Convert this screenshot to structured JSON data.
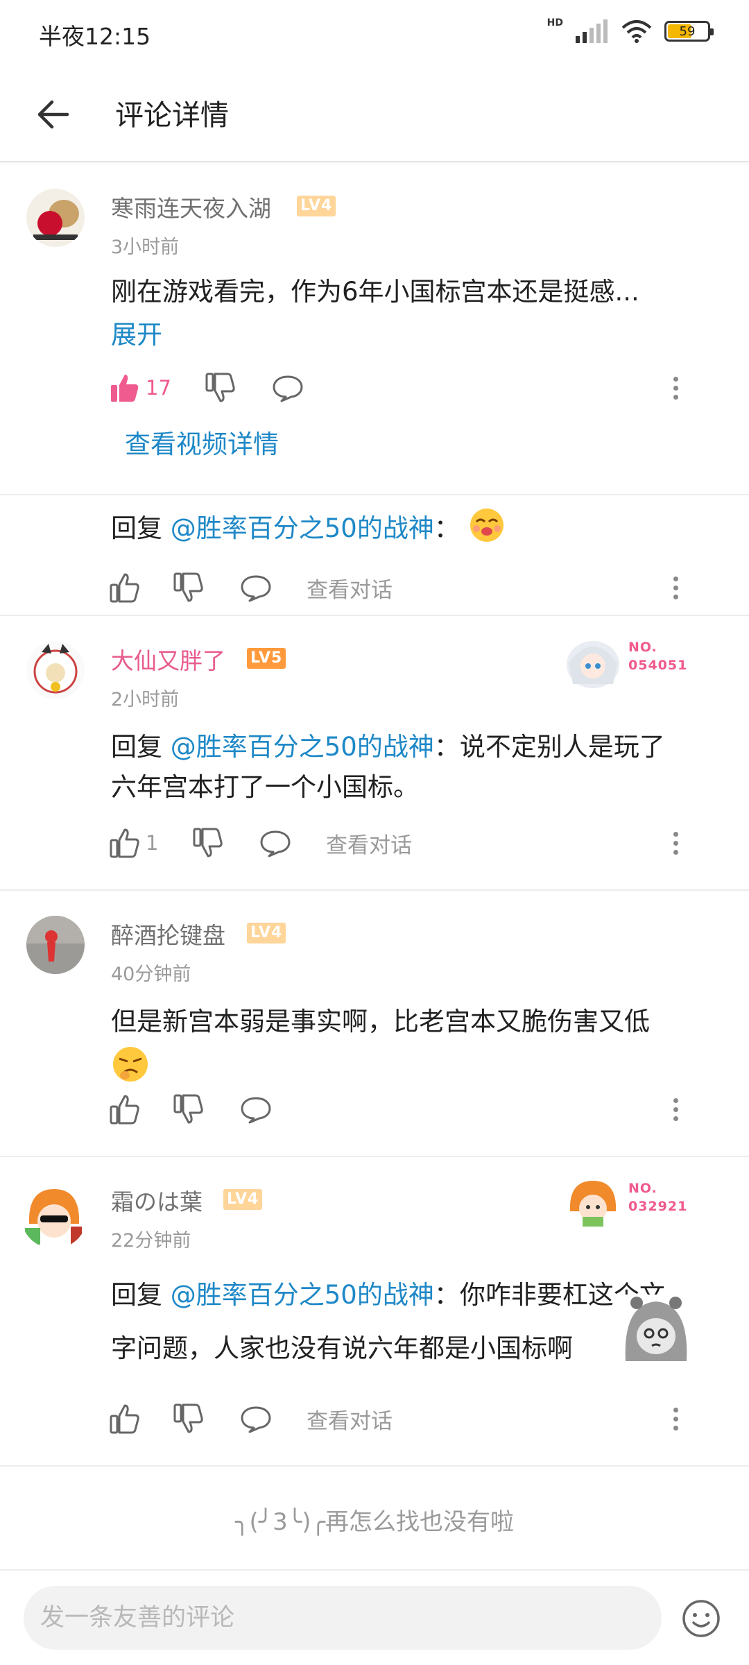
{
  "status_bar": {
    "time": "半夜12:15",
    "network": "HD",
    "battery": "59"
  },
  "header": {
    "title": "评论详情"
  },
  "colors": {
    "accent_blue": "#1e88c7",
    "vip_pink": "#e85b8e",
    "like_pink": "#ef5a8f"
  },
  "main_comment": {
    "username": "寒雨连天夜入湖",
    "level": "LV4",
    "time": "3小时前",
    "text": "刚在游戏看完，作为6年小国标宫本还是挺感...",
    "expand_label": "展开",
    "likes": "17",
    "video_link": "查看视频详情"
  },
  "replies": [
    {
      "reply_prefix": "回复",
      "mention": "@胜率百分之50的战神",
      "text": "：",
      "emoji": "smug-face-emoji",
      "view_conversation": "查看对话"
    },
    {
      "username": "大仙又胖了",
      "level": "LV5",
      "time": "2小时前",
      "badge_label": "NO.",
      "badge_number": "054051",
      "reply_prefix": "回复",
      "mention": "@胜率百分之50的战神",
      "text_line1": "：说不定别人是玩了",
      "text_line2": "六年宫本打了一个小国标。",
      "likes": "1",
      "view_conversation": "查看对话"
    },
    {
      "username": "醉酒抡键盘",
      "level": "LV4",
      "time": "40分钟前",
      "text": "但是新宫本弱是事实啊，比老宫本又脆伤害又低",
      "emoji": "disgusted-face-emoji"
    },
    {
      "username": "霜のは葉",
      "level": "LV4",
      "time": "22分钟前",
      "badge_label": "NO.",
      "badge_number": "032921",
      "reply_prefix": "回复",
      "mention": "@胜率百分之50的战神",
      "text_line1": "：你咋非要杠这个文",
      "text_line2": "字问题，人家也没有说六年都是小国标啊",
      "sticker": "sketch-girl-sticker",
      "view_conversation": "查看对话"
    }
  ],
  "footer_note": "╮(╯3╰)╭再怎么找也没有啦",
  "bottom_bar": {
    "input_placeholder": "发一条友善的评论"
  }
}
